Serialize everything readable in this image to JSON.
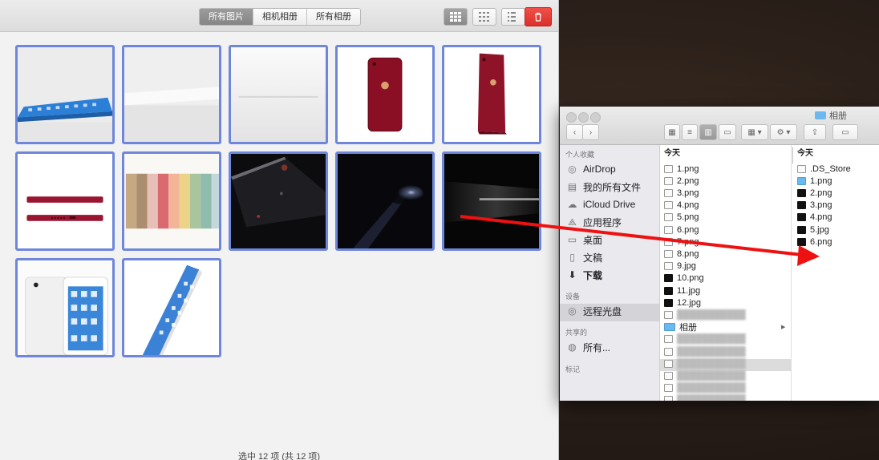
{
  "photo_window": {
    "tabs": [
      {
        "label": "所有图片",
        "active": true
      },
      {
        "label": "相机相册",
        "active": false
      },
      {
        "label": "所有相册",
        "active": false
      }
    ],
    "view_buttons": [
      {
        "icon": "large-grid-icon",
        "active": true
      },
      {
        "icon": "medium-grid-icon",
        "active": false
      },
      {
        "icon": "small-grid-icon",
        "active": false
      }
    ],
    "delete_icon": "trash-icon",
    "thumbnails": [
      {
        "subject": "tablet-flat"
      },
      {
        "subject": "white-device-flat"
      },
      {
        "subject": "white-surface"
      },
      {
        "subject": "red-phone-back"
      },
      {
        "subject": "red-phone-angle"
      },
      {
        "subject": "red-phone-sides"
      },
      {
        "subject": "color-swatches"
      },
      {
        "subject": "dark-phone-edge"
      },
      {
        "subject": "dark-light-streak"
      },
      {
        "subject": "dark-tunnel"
      },
      {
        "subject": "white-phones-front"
      },
      {
        "subject": "tablet-tilted"
      }
    ],
    "status": "选中 12 项 (共 12 项)"
  },
  "finder": {
    "title": "相册",
    "sidebar": {
      "favorites_header": "个人收藏",
      "favorites": [
        {
          "label": "AirDrop",
          "icon": "airdrop-icon"
        },
        {
          "label": "我的所有文件",
          "icon": "all-files-icon"
        },
        {
          "label": "iCloud Drive",
          "icon": "cloud-icon"
        },
        {
          "label": "应用程序",
          "icon": "applications-icon"
        },
        {
          "label": "桌面",
          "icon": "desktop-icon"
        },
        {
          "label": "文稿",
          "icon": "documents-icon"
        },
        {
          "label": "下载",
          "icon": "download-icon",
          "selected": true
        }
      ],
      "devices_header": "设备",
      "devices": [
        {
          "label": "远程光盘",
          "icon": "disc-icon"
        }
      ],
      "shared_header": "共享的",
      "shared": [
        {
          "label": "所有...",
          "icon": "network-icon"
        }
      ],
      "tags_header": "标记"
    },
    "column1": {
      "header": "今天",
      "files": [
        {
          "name": "1.png",
          "kind": "light"
        },
        {
          "name": "2.png",
          "kind": "light"
        },
        {
          "name": "3.png",
          "kind": "light"
        },
        {
          "name": "4.png",
          "kind": "light"
        },
        {
          "name": "5.png",
          "kind": "light"
        },
        {
          "name": "6.png",
          "kind": "light"
        },
        {
          "name": "7.png",
          "kind": "light"
        },
        {
          "name": "8.png",
          "kind": "light"
        },
        {
          "name": "9.jpg",
          "kind": "light"
        },
        {
          "name": "10.png",
          "kind": "dark"
        },
        {
          "name": "11.jpg",
          "kind": "dark"
        },
        {
          "name": "12.jpg",
          "kind": "dark"
        },
        {
          "name": "BLURRED",
          "kind": "light",
          "blurred": true
        },
        {
          "name": "相册",
          "kind": "folder",
          "selected": true
        },
        {
          "name": "BLURRED",
          "kind": "light",
          "blurred": true
        },
        {
          "name": "BLURRED",
          "kind": "light",
          "blurred": true
        },
        {
          "name": "BLURRED",
          "kind": "light",
          "blurred": true
        },
        {
          "name": "BLURRED",
          "kind": "light",
          "blurred": true
        },
        {
          "name": "BLURRED",
          "kind": "light",
          "blurred": true
        },
        {
          "name": "BLURRED",
          "kind": "light",
          "blurred": true
        }
      ]
    },
    "column2": {
      "header": "今天",
      "files": [
        {
          "name": ".DS_Store",
          "kind": "light"
        },
        {
          "name": "1.png",
          "kind": "blue"
        },
        {
          "name": "2.png",
          "kind": "dark"
        },
        {
          "name": "3.png",
          "kind": "dark"
        },
        {
          "name": "4.png",
          "kind": "dark"
        },
        {
          "name": "5.jpg",
          "kind": "dark"
        },
        {
          "name": "6.png",
          "kind": "dark"
        }
      ]
    }
  },
  "colors": {
    "selection_border": "#6e87dc",
    "arrow": "#ee1111",
    "delete": "#e43b35"
  }
}
